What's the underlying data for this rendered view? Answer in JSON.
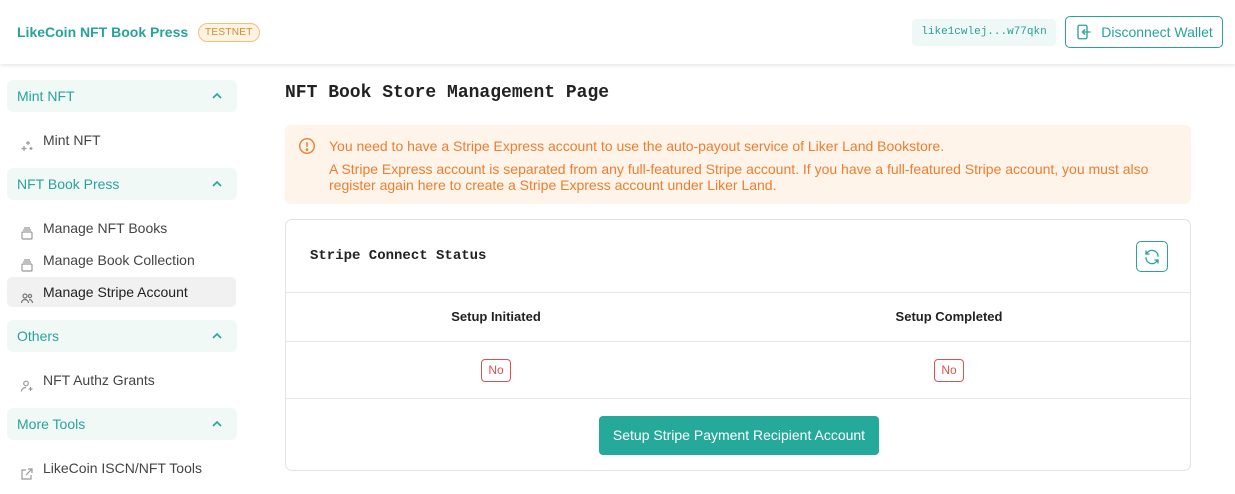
{
  "header": {
    "brand": "LikeCoin NFT Book Press",
    "network_badge": "TESTNET",
    "wallet_address": "like1cwlej...w77qkn",
    "disconnect_label": "Disconnect Wallet"
  },
  "sidebar": {
    "groups": [
      {
        "label": "Mint NFT",
        "items": [
          {
            "label": "Mint NFT",
            "icon": "sparkle-icon"
          }
        ]
      },
      {
        "label": "NFT Book Press",
        "items": [
          {
            "label": "Manage NFT Books",
            "icon": "book-stack-icon"
          },
          {
            "label": "Manage Book Collection",
            "icon": "book-stack-icon"
          },
          {
            "label": "Manage Stripe Account",
            "icon": "users-icon",
            "active": true
          }
        ]
      },
      {
        "label": "Others",
        "items": [
          {
            "label": "NFT Authz Grants",
            "icon": "user-add-icon"
          }
        ]
      },
      {
        "label": "More Tools",
        "items": [
          {
            "label": "LikeCoin ISCN/NFT Tools",
            "icon": "external-link-icon"
          }
        ]
      }
    ]
  },
  "main": {
    "title": "NFT Book Store Management Page",
    "alert": {
      "line1": "You need to have a Stripe Express account to use the auto-payout service of Liker Land Bookstore.",
      "line2": "A Stripe Express account is separated from any full-featured Stripe account. If you have a full-featured Stripe account, you must also",
      "line3": "register again here to create a Stripe Express account under Liker Land."
    },
    "card": {
      "title": "Stripe Connect Status",
      "columns": [
        "Setup Initiated",
        "Setup Completed"
      ],
      "values": [
        "No",
        "No"
      ],
      "button": "Setup Stripe Payment Recipient Account"
    }
  },
  "colors": {
    "accent": "#28a39a",
    "warning_text": "#ee7d2f",
    "warning_bg": "#fff4ea",
    "danger": "#d9534f"
  }
}
